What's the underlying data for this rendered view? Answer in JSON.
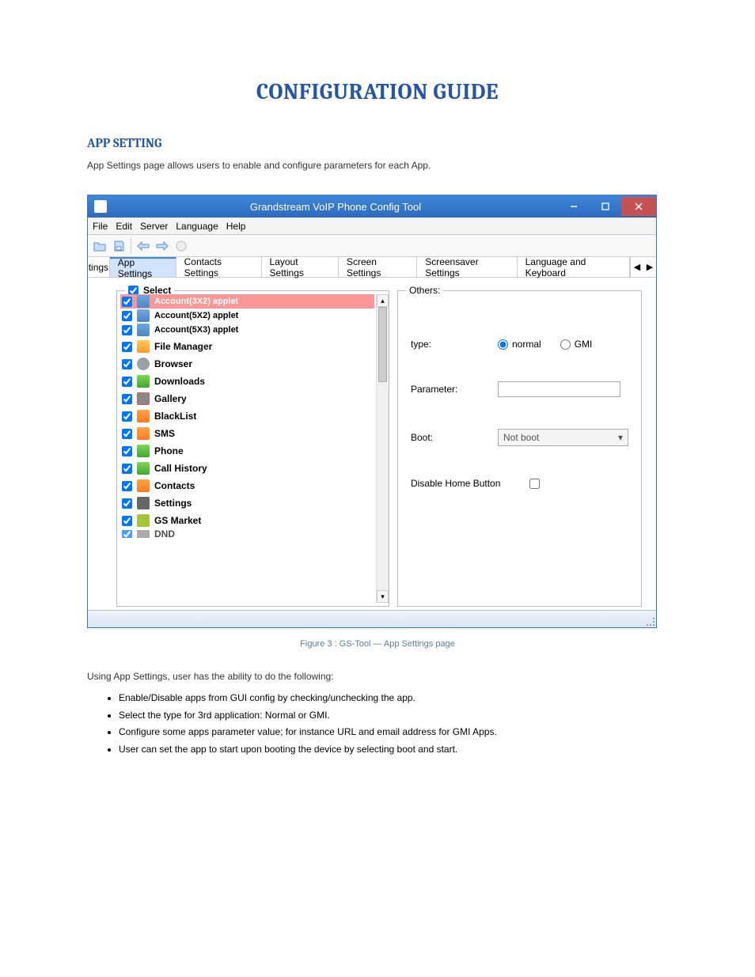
{
  "doc": {
    "title": "CONFIGURATION GUIDE",
    "section_heading": "APP SETTING",
    "section_desc": "App Settings page allows users to enable and configure parameters for each App."
  },
  "window": {
    "title": "Grandstream VoIP Phone Config Tool",
    "menu": [
      "File",
      "Edit",
      "Server",
      "Language",
      "Help"
    ]
  },
  "tabs": {
    "cut_label": "tings",
    "items": [
      {
        "label": "App Settings",
        "active": true
      },
      {
        "label": "Contacts Settings",
        "active": false
      },
      {
        "label": "Layout Settings",
        "active": false
      },
      {
        "label": "Screen Settings",
        "active": false
      },
      {
        "label": "Screensaver Settings",
        "active": false
      },
      {
        "label": "Language and Keyboard",
        "active": false
      }
    ]
  },
  "select_panel": {
    "group_label": "Select",
    "items": [
      {
        "label": "Account(3X2) applet",
        "icon": "blue-grid",
        "selected": true,
        "tight": true
      },
      {
        "label": "Account(5X2) applet",
        "icon": "blue-grid",
        "selected": false,
        "tight": true
      },
      {
        "label": "Account(5X3) applet",
        "icon": "blue-grid",
        "selected": false,
        "tight": true
      },
      {
        "label": "File Manager",
        "icon": "folder",
        "selected": false
      },
      {
        "label": "Browser",
        "icon": "globe",
        "selected": false
      },
      {
        "label": "Downloads",
        "icon": "download",
        "selected": false
      },
      {
        "label": "Gallery",
        "icon": "gallery",
        "selected": false
      },
      {
        "label": "BlackList",
        "icon": "blk",
        "selected": false
      },
      {
        "label": "SMS",
        "icon": "sms",
        "selected": false
      },
      {
        "label": "Phone",
        "icon": "phone",
        "selected": false
      },
      {
        "label": "Call History",
        "icon": "hist",
        "selected": false
      },
      {
        "label": "Contacts",
        "icon": "contacts",
        "selected": false
      },
      {
        "label": "Settings",
        "icon": "gear",
        "selected": false
      },
      {
        "label": "GS Market",
        "icon": "android",
        "selected": false
      },
      {
        "label": "DND",
        "icon": "dnd",
        "selected": false,
        "cut": true
      }
    ]
  },
  "others_panel": {
    "group_label": "Others:",
    "type_label": "type:",
    "type_options": {
      "normal": "normal",
      "gmi": "GMI"
    },
    "type_selected": "normal",
    "parameter_label": "Parameter:",
    "parameter_value": "",
    "boot_label": "Boot:",
    "boot_value": "Not boot",
    "disable_home_label": "Disable Home Button",
    "disable_home_checked": false
  },
  "figure_caption": "Figure 3 : GS-Tool — App Settings page",
  "body_text": "Using App Settings, user has the ability to do the following:",
  "bullets": [
    "Enable/Disable apps from GUI config by checking/unchecking the app.",
    "Select the type for 3rd application: Normal or GMI.",
    "Configure some apps parameter value; for instance URL and email address for GMI Apps.",
    "User can set the app to start upon booting the device by selecting boot and start."
  ]
}
